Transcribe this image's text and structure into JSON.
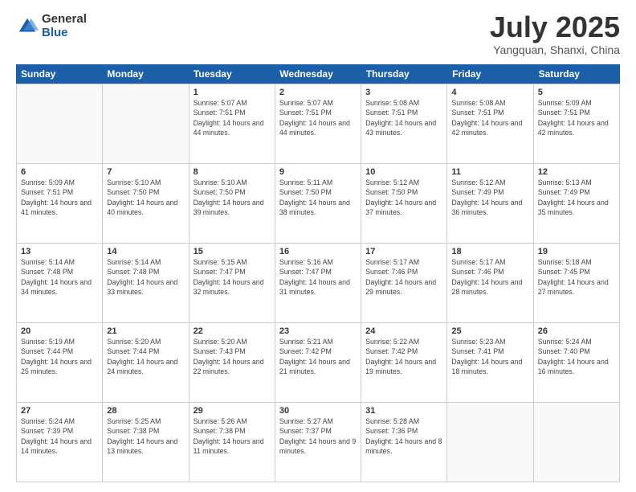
{
  "logo": {
    "general": "General",
    "blue": "Blue"
  },
  "title": "July 2025",
  "location": "Yangquan, Shanxi, China",
  "weekdays": [
    "Sunday",
    "Monday",
    "Tuesday",
    "Wednesday",
    "Thursday",
    "Friday",
    "Saturday"
  ],
  "weeks": [
    [
      {
        "day": "",
        "empty": true
      },
      {
        "day": "",
        "empty": true
      },
      {
        "day": "1",
        "sunrise": "Sunrise: 5:07 AM",
        "sunset": "Sunset: 7:51 PM",
        "daylight": "Daylight: 14 hours and 44 minutes."
      },
      {
        "day": "2",
        "sunrise": "Sunrise: 5:07 AM",
        "sunset": "Sunset: 7:51 PM",
        "daylight": "Daylight: 14 hours and 44 minutes."
      },
      {
        "day": "3",
        "sunrise": "Sunrise: 5:08 AM",
        "sunset": "Sunset: 7:51 PM",
        "daylight": "Daylight: 14 hours and 43 minutes."
      },
      {
        "day": "4",
        "sunrise": "Sunrise: 5:08 AM",
        "sunset": "Sunset: 7:51 PM",
        "daylight": "Daylight: 14 hours and 42 minutes."
      },
      {
        "day": "5",
        "sunrise": "Sunrise: 5:09 AM",
        "sunset": "Sunset: 7:51 PM",
        "daylight": "Daylight: 14 hours and 42 minutes."
      }
    ],
    [
      {
        "day": "6",
        "sunrise": "Sunrise: 5:09 AM",
        "sunset": "Sunset: 7:51 PM",
        "daylight": "Daylight: 14 hours and 41 minutes."
      },
      {
        "day": "7",
        "sunrise": "Sunrise: 5:10 AM",
        "sunset": "Sunset: 7:50 PM",
        "daylight": "Daylight: 14 hours and 40 minutes."
      },
      {
        "day": "8",
        "sunrise": "Sunrise: 5:10 AM",
        "sunset": "Sunset: 7:50 PM",
        "daylight": "Daylight: 14 hours and 39 minutes."
      },
      {
        "day": "9",
        "sunrise": "Sunrise: 5:11 AM",
        "sunset": "Sunset: 7:50 PM",
        "daylight": "Daylight: 14 hours and 38 minutes."
      },
      {
        "day": "10",
        "sunrise": "Sunrise: 5:12 AM",
        "sunset": "Sunset: 7:50 PM",
        "daylight": "Daylight: 14 hours and 37 minutes."
      },
      {
        "day": "11",
        "sunrise": "Sunrise: 5:12 AM",
        "sunset": "Sunset: 7:49 PM",
        "daylight": "Daylight: 14 hours and 36 minutes."
      },
      {
        "day": "12",
        "sunrise": "Sunrise: 5:13 AM",
        "sunset": "Sunset: 7:49 PM",
        "daylight": "Daylight: 14 hours and 35 minutes."
      }
    ],
    [
      {
        "day": "13",
        "sunrise": "Sunrise: 5:14 AM",
        "sunset": "Sunset: 7:48 PM",
        "daylight": "Daylight: 14 hours and 34 minutes."
      },
      {
        "day": "14",
        "sunrise": "Sunrise: 5:14 AM",
        "sunset": "Sunset: 7:48 PM",
        "daylight": "Daylight: 14 hours and 33 minutes."
      },
      {
        "day": "15",
        "sunrise": "Sunrise: 5:15 AM",
        "sunset": "Sunset: 7:47 PM",
        "daylight": "Daylight: 14 hours and 32 minutes."
      },
      {
        "day": "16",
        "sunrise": "Sunrise: 5:16 AM",
        "sunset": "Sunset: 7:47 PM",
        "daylight": "Daylight: 14 hours and 31 minutes."
      },
      {
        "day": "17",
        "sunrise": "Sunrise: 5:17 AM",
        "sunset": "Sunset: 7:46 PM",
        "daylight": "Daylight: 14 hours and 29 minutes."
      },
      {
        "day": "18",
        "sunrise": "Sunrise: 5:17 AM",
        "sunset": "Sunset: 7:46 PM",
        "daylight": "Daylight: 14 hours and 28 minutes."
      },
      {
        "day": "19",
        "sunrise": "Sunrise: 5:18 AM",
        "sunset": "Sunset: 7:45 PM",
        "daylight": "Daylight: 14 hours and 27 minutes."
      }
    ],
    [
      {
        "day": "20",
        "sunrise": "Sunrise: 5:19 AM",
        "sunset": "Sunset: 7:44 PM",
        "daylight": "Daylight: 14 hours and 25 minutes."
      },
      {
        "day": "21",
        "sunrise": "Sunrise: 5:20 AM",
        "sunset": "Sunset: 7:44 PM",
        "daylight": "Daylight: 14 hours and 24 minutes."
      },
      {
        "day": "22",
        "sunrise": "Sunrise: 5:20 AM",
        "sunset": "Sunset: 7:43 PM",
        "daylight": "Daylight: 14 hours and 22 minutes."
      },
      {
        "day": "23",
        "sunrise": "Sunrise: 5:21 AM",
        "sunset": "Sunset: 7:42 PM",
        "daylight": "Daylight: 14 hours and 21 minutes."
      },
      {
        "day": "24",
        "sunrise": "Sunrise: 5:22 AM",
        "sunset": "Sunset: 7:42 PM",
        "daylight": "Daylight: 14 hours and 19 minutes."
      },
      {
        "day": "25",
        "sunrise": "Sunrise: 5:23 AM",
        "sunset": "Sunset: 7:41 PM",
        "daylight": "Daylight: 14 hours and 18 minutes."
      },
      {
        "day": "26",
        "sunrise": "Sunrise: 5:24 AM",
        "sunset": "Sunset: 7:40 PM",
        "daylight": "Daylight: 14 hours and 16 minutes."
      }
    ],
    [
      {
        "day": "27",
        "sunrise": "Sunrise: 5:24 AM",
        "sunset": "Sunset: 7:39 PM",
        "daylight": "Daylight: 14 hours and 14 minutes."
      },
      {
        "day": "28",
        "sunrise": "Sunrise: 5:25 AM",
        "sunset": "Sunset: 7:38 PM",
        "daylight": "Daylight: 14 hours and 13 minutes."
      },
      {
        "day": "29",
        "sunrise": "Sunrise: 5:26 AM",
        "sunset": "Sunset: 7:38 PM",
        "daylight": "Daylight: 14 hours and 11 minutes."
      },
      {
        "day": "30",
        "sunrise": "Sunrise: 5:27 AM",
        "sunset": "Sunset: 7:37 PM",
        "daylight": "Daylight: 14 hours and 9 minutes."
      },
      {
        "day": "31",
        "sunrise": "Sunrise: 5:28 AM",
        "sunset": "Sunset: 7:36 PM",
        "daylight": "Daylight: 14 hours and 8 minutes."
      },
      {
        "day": "",
        "empty": true
      },
      {
        "day": "",
        "empty": true
      }
    ]
  ]
}
